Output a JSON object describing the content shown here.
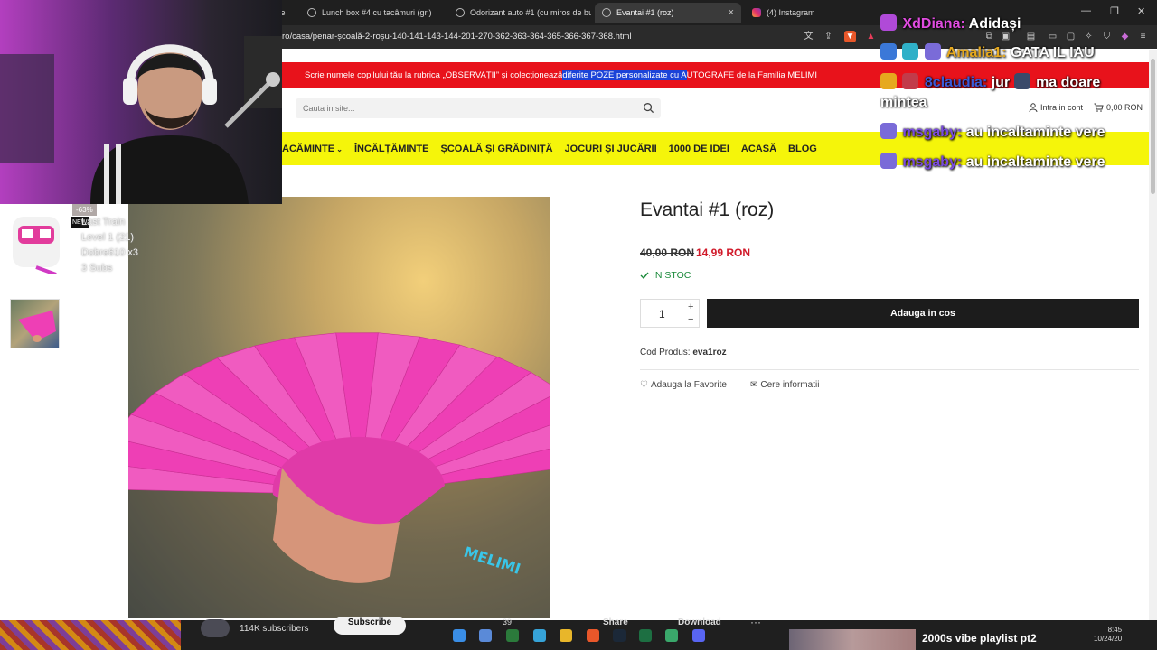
{
  "browser": {
    "tabs": [
      {
        "title": "fe",
        "icon": "globe"
      },
      {
        "title": "Lunch box #4 cu tacâmuri (gri)",
        "icon": "globe"
      },
      {
        "title": "Odorizant auto #1 (cu miros de bubble",
        "icon": "globe"
      },
      {
        "title": "Evantai #1 (roz)",
        "icon": "globe",
        "active": true,
        "close": "×"
      },
      {
        "title": "(4) Instagram",
        "icon": "instagram"
      }
    ],
    "url": "ro/casa/penar-școală-2-roșu-140-141-143-144-201-270-362-363-364-365-366-367-368.html",
    "window_controls": {
      "min": "—",
      "max": "❐",
      "close": "✕"
    }
  },
  "site": {
    "announcement": {
      "before": "Scrie numele copilului tău la rubrica „OBSERVAȚII” și colecționează ",
      "highlight": "diferite POZE personalizate cu A",
      "after": "UTOGRAFE de la Familia MELIMI"
    },
    "search": {
      "placeholder": "Cauta in site..."
    },
    "account_label": "Intra in cont",
    "cart_label": "0,00 RON",
    "nav": [
      {
        "label": "ACĂMINTE",
        "has_dropdown": true
      },
      {
        "label": "ÎNCĂLȚĂMINTE"
      },
      {
        "label": "ȘCOALĂ ȘI GRĂDINIȚĂ"
      },
      {
        "label": "JOCURI ȘI JUCĂRII"
      },
      {
        "label": "1000 DE IDEI"
      },
      {
        "label": "ACASĂ"
      },
      {
        "label": "BLOG"
      }
    ],
    "product": {
      "title": "Evantai #1 (roz)",
      "price_old": "40,00 RON",
      "price_new": "14,99 RON",
      "stock": "IN STOC",
      "quantity": "1",
      "plus": "+",
      "minus": "−",
      "add_to_cart": "Adauga in cos",
      "sku_label": "Cod Produs:",
      "sku_value": "eva1roz",
      "favorite": "Adauga la Favorite",
      "info": "Cere informatii",
      "brand_logo_text": "MELIMI",
      "fan_color": "#ee3fb5"
    }
  },
  "overlay": {
    "sub_alert": {
      "percent": "-63%",
      "badge": "NEW",
      "lines": [
        "Last Train",
        "Level 1 (21)",
        "Dobre610 x3",
        "3 Subs"
      ]
    },
    "chat": [
      {
        "user": "XdDiana:",
        "message": "Adidași",
        "color": "pink"
      },
      {
        "user": "Amalia1:",
        "message": "GATA IL IAU",
        "color": "gold"
      },
      {
        "user": "8claudia:",
        "message": "jur",
        "message2": "ma doare",
        "message3": "mintea",
        "color": "blue"
      },
      {
        "user": "msgaby:",
        "message": "au incaltaminte vere",
        "color": "purple"
      },
      {
        "user": "msgaby:",
        "message": "au incaltaminte vere",
        "color": "purple"
      }
    ]
  },
  "bottom": {
    "subscribers": "114K subscribers",
    "subscribe": "Subscribe",
    "count": "39",
    "share": "Share",
    "download": "Download",
    "more": "···",
    "music": "2000s vibe playlist pt2",
    "time": "8:45",
    "date": "10/24/20"
  },
  "colors": {
    "announce_bg": "#e8121b",
    "nav_bg": "#f5f50a",
    "price_new": "#d11a2a",
    "stock": "#1b8a3b",
    "button_bg": "#1c1c1c"
  }
}
